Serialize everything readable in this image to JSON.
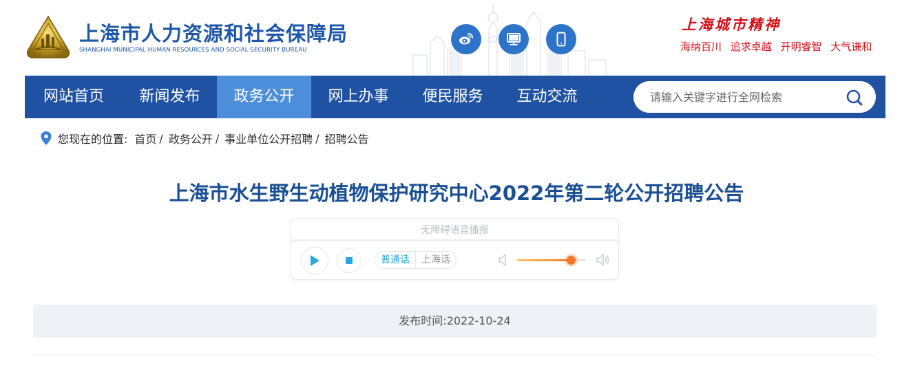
{
  "header": {
    "site_title": "上海市人力资源和社会保障局",
    "site_subtitle": "SHANGHAI MUNICIPAL HUMAN RESOURCES AND SOCIAL SECURITY BUREAU",
    "spirit_title": "上海城市精神",
    "spirit_phrases": [
      "海纳百川",
      "追求卓越",
      "开明睿智",
      "大气谦和"
    ],
    "icons": [
      "weibo-icon",
      "desktop-icon",
      "mobile-icon"
    ]
  },
  "nav": {
    "items": [
      {
        "label": "网站首页",
        "active": false
      },
      {
        "label": "新闻发布",
        "active": false
      },
      {
        "label": "政务公开",
        "active": true
      },
      {
        "label": "网上办事",
        "active": false
      },
      {
        "label": "便民服务",
        "active": false
      },
      {
        "label": "互动交流",
        "active": false
      }
    ],
    "search_placeholder": "请输入关键字进行全网检索"
  },
  "breadcrumb": {
    "label": "您现在的位置:",
    "items": [
      "首页",
      "政务公开",
      "事业单位公开招聘",
      "招聘公告"
    ]
  },
  "article": {
    "title": "上海市水生野生动植物保护研究中心2022年第二轮公开招聘公告",
    "publish_label": "发布时间:",
    "publish_date": "2022-10-24",
    "publish_text": "发布时间:2022-10-24"
  },
  "player": {
    "label": "无障碍语音播报",
    "lang_options": [
      "普通话",
      "上海话"
    ],
    "selected_lang": "普通话",
    "volume": 0.78
  },
  "colors": {
    "brand_blue": "#1f52a3",
    "nav_active": "#4c8ed9",
    "title_blue": "#1a4f93",
    "spirit_red": "#d0121b",
    "accent_orange": "#f5772a"
  }
}
